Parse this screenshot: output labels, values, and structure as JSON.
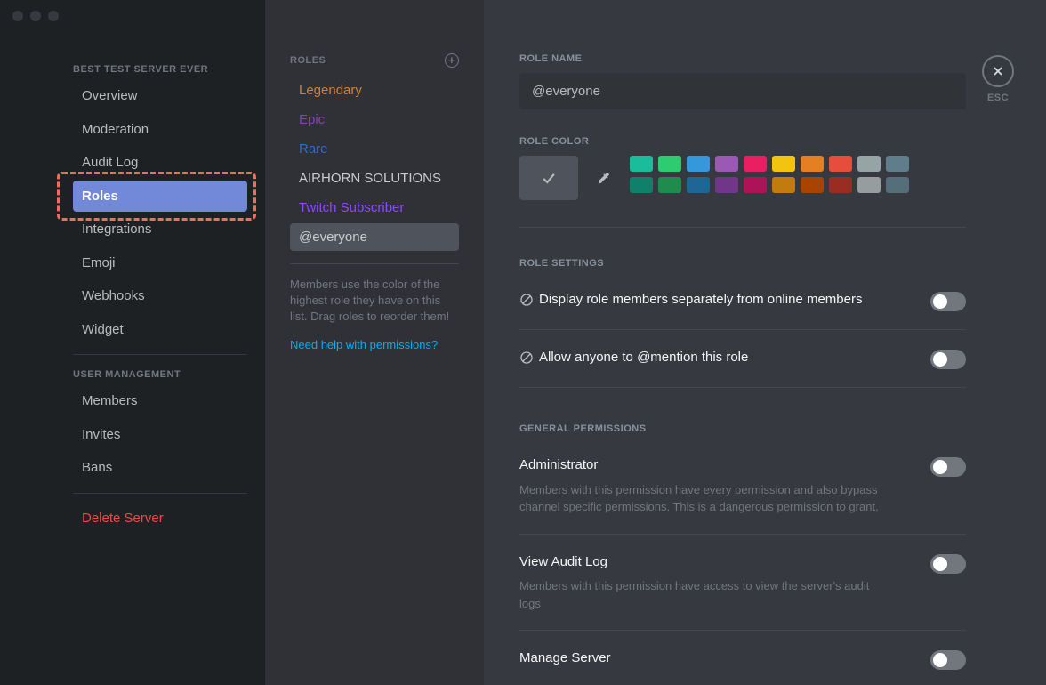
{
  "serverName": "BEST TEST SERVER EVER",
  "sidebar": {
    "items": [
      {
        "label": "Overview"
      },
      {
        "label": "Moderation"
      },
      {
        "label": "Audit Log"
      },
      {
        "label": "Roles"
      },
      {
        "label": "Integrations"
      },
      {
        "label": "Emoji"
      },
      {
        "label": "Webhooks"
      },
      {
        "label": "Widget"
      }
    ],
    "userMgmtHeader": "USER MANAGEMENT",
    "userMgmt": [
      {
        "label": "Members"
      },
      {
        "label": "Invites"
      },
      {
        "label": "Bans"
      }
    ],
    "deleteLabel": "Delete Server"
  },
  "rolesColumn": {
    "header": "ROLES",
    "roles": [
      {
        "label": "Legendary",
        "color": "#d67f2e"
      },
      {
        "label": "Epic",
        "color": "#8b3cc2"
      },
      {
        "label": "Rare",
        "color": "#2e6bd6"
      },
      {
        "label": "AIRHORN SOLUTIONS",
        "color": "#c9cbce"
      },
      {
        "label": "Twitch Subscriber",
        "color": "#9146ff"
      },
      {
        "label": "@everyone",
        "color": "#c9cbce"
      }
    ],
    "helpText": "Members use the color of the highest role they have on this list. Drag roles to reorder them!",
    "helpLink": "Need help with permissions?"
  },
  "main": {
    "roleNameLabel": "ROLE NAME",
    "roleNameValue": "@everyone",
    "roleColorLabel": "ROLE COLOR",
    "colorsRow1": [
      "#1abc9c",
      "#2ecc71",
      "#3498db",
      "#9b59b6",
      "#e91e63",
      "#f1c40f",
      "#e67e22",
      "#e74c3c",
      "#95a5a6",
      "#607d8b"
    ],
    "colorsRow2": [
      "#11806a",
      "#1f8b4c",
      "#206694",
      "#71368a",
      "#ad1457",
      "#c27c0e",
      "#a84300",
      "#992d22",
      "#979c9f",
      "#546e7a"
    ],
    "roleSettingsLabel": "ROLE SETTINGS",
    "setting1": "Display role members separately from online members",
    "setting2": "Allow anyone to @mention this role",
    "generalPermsLabel": "GENERAL PERMISSIONS",
    "perm1Title": "Administrator",
    "perm1Desc": "Members with this permission have every permission and also bypass channel specific permissions. This is a dangerous permission to grant.",
    "perm2Title": "View Audit Log",
    "perm2Desc": "Members with this permission have access to view the server's audit logs",
    "perm3Title": "Manage Server"
  },
  "close": {
    "label": "ESC"
  }
}
